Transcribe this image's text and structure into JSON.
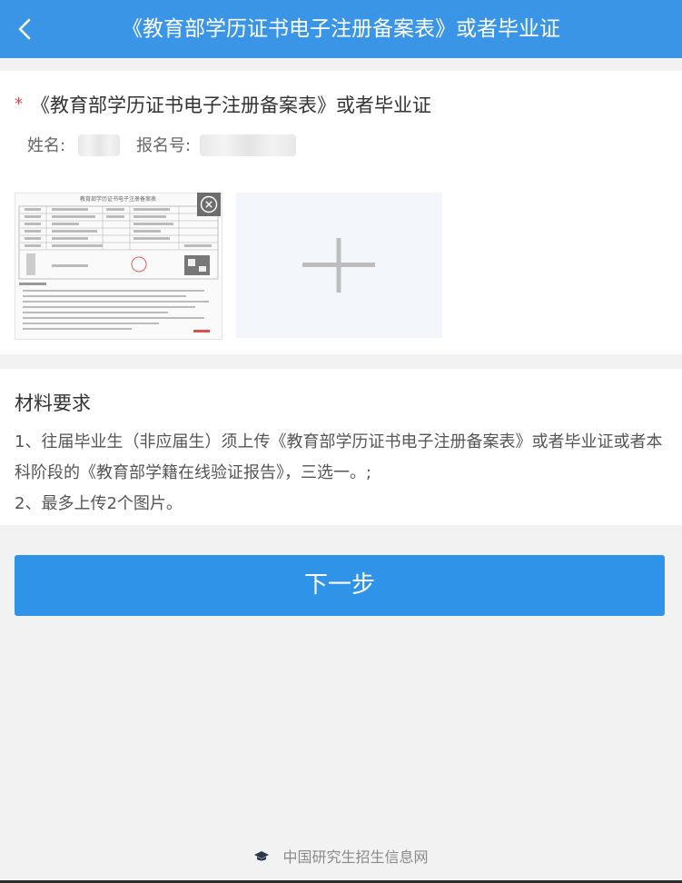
{
  "header": {
    "title": "《教育部学历证书电子注册备案表》或者毕业证"
  },
  "upload": {
    "required_mark": "*",
    "title": "《教育部学历证书电子注册备案表》或者毕业证",
    "name_label": "姓名:",
    "reg_label": "报名号:",
    "thumbnail_title": "教育部学历证书电子注册备案表"
  },
  "requirements": {
    "title": "材料要求",
    "line1": "1、往届毕业生（非应届生）须上传《教育部学历证书电子注册备案表》或者毕业证或者本科阶段的《教育部学籍在线验证报告》，三选一。;",
    "line2": "2、最多上传2个图片。"
  },
  "actions": {
    "next_label": "下一步"
  },
  "footer": {
    "site_name": "中国研究生招生信息网"
  },
  "icons": {
    "back": "chevron-left-icon",
    "close": "close-circle-icon",
    "add": "plus-icon",
    "footer": "graduation-cap-icon"
  },
  "colors": {
    "header": "#3a95e6",
    "button": "#2f93e8",
    "required": "#e84a4a"
  }
}
